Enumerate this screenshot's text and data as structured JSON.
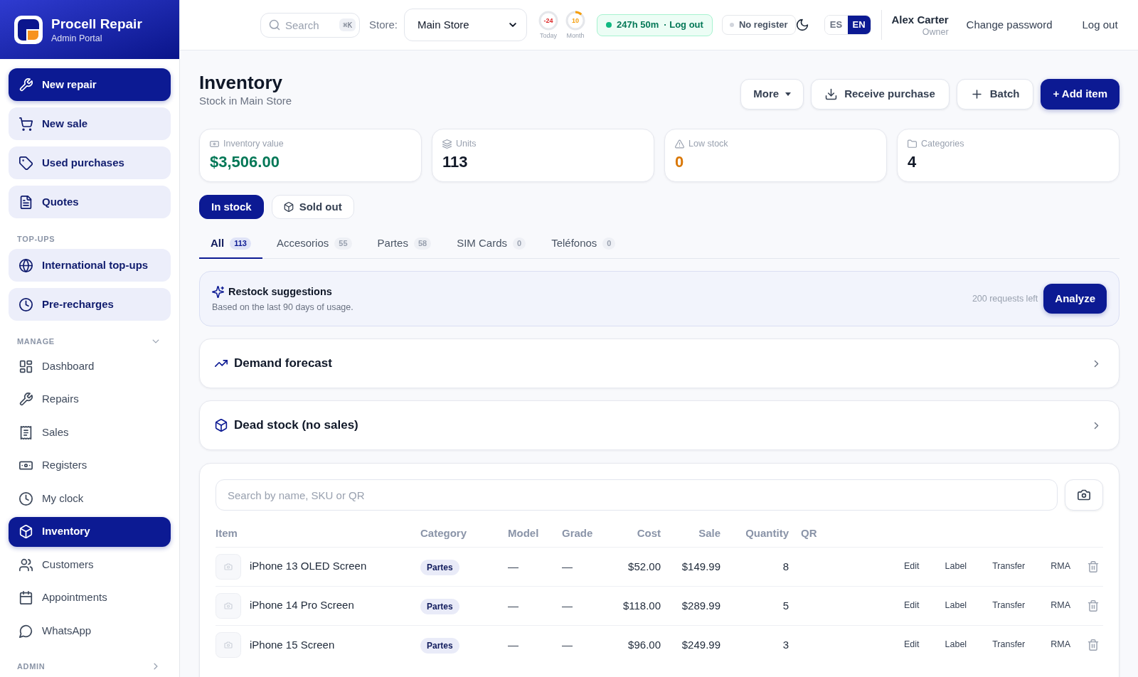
{
  "sidebar": {
    "brand": {
      "title": "Procell Repair",
      "subtitle": "Admin Portal"
    },
    "sections": [
      {
        "items": [
          {
            "label": "New repair",
            "kind": "primary"
          },
          {
            "label": "New sale",
            "kind": "action"
          },
          {
            "label": "Used purchases",
            "kind": "action"
          },
          {
            "label": "Quotes",
            "kind": "action"
          }
        ]
      },
      {
        "title": "TOP-UPS",
        "items": [
          {
            "label": "International top-ups",
            "kind": "action"
          },
          {
            "label": "Pre-recharges",
            "kind": "action"
          }
        ]
      },
      {
        "title": "MANAGE",
        "expanded": true,
        "items": [
          {
            "label": "Dashboard",
            "kind": "link",
            "selected": false
          },
          {
            "label": "Repairs",
            "kind": "link",
            "selected": false
          },
          {
            "label": "Sales",
            "kind": "link",
            "selected": false
          },
          {
            "label": "Registers",
            "kind": "link",
            "selected": false
          },
          {
            "label": "My clock",
            "kind": "link",
            "selected": false
          },
          {
            "label": "Inventory",
            "kind": "link",
            "selected": true
          },
          {
            "label": "Customers",
            "kind": "link",
            "selected": false
          },
          {
            "label": "Appointments",
            "kind": "link",
            "selected": false
          },
          {
            "label": "WhatsApp",
            "kind": "link",
            "selected": false
          }
        ]
      },
      {
        "title": "ADMIN",
        "expanded": false
      }
    ]
  },
  "topbar": {
    "search": {
      "placeholder": "Search",
      "shortcut": "⌘K"
    },
    "store": {
      "label": "Store:",
      "value": "Main Store"
    },
    "meters": [
      {
        "value": "-24",
        "caption": "Today",
        "level": 0,
        "color": "#dc2626"
      },
      {
        "value": "10",
        "caption": "Month",
        "level": 0.12,
        "color": "#f59e0b"
      }
    ],
    "clock": {
      "duration": "247h 50m",
      "action": "· Log out"
    },
    "register": {
      "label": "No register"
    },
    "languages": [
      {
        "label": "ES",
        "selected": false
      },
      {
        "label": "EN",
        "selected": true
      }
    ],
    "user": {
      "name": "Alex Carter",
      "role": "Owner"
    },
    "links": [
      "Change password",
      "Log out"
    ]
  },
  "page": {
    "title": "Inventory",
    "subtitle": "Stock in Main Store",
    "actions": [
      {
        "label": "More",
        "kind": "menu"
      },
      {
        "label": "Receive purchase",
        "kind": "secondary"
      },
      {
        "label": "Batch",
        "kind": "secondary"
      },
      {
        "label": "+ Add item",
        "kind": "primary"
      }
    ]
  },
  "stats": [
    {
      "label": "Inventory value",
      "value": "$3,506.00",
      "color": "#047857"
    },
    {
      "label": "Units",
      "value": "113",
      "color": "#111827"
    },
    {
      "label": "Low stock",
      "value": "0",
      "color": "#d97706"
    },
    {
      "label": "Categories",
      "value": "4",
      "color": "#111827"
    }
  ],
  "stock_filter": [
    {
      "label": "In stock",
      "selected": true
    },
    {
      "label": "Sold out",
      "selected": false
    }
  ],
  "category_tabs": [
    {
      "label": "All",
      "count": "113",
      "selected": true
    },
    {
      "label": "Accesorios",
      "count": "55",
      "selected": false
    },
    {
      "label": "Partes",
      "count": "58",
      "selected": false
    },
    {
      "label": "SIM Cards",
      "count": "0",
      "selected": false
    },
    {
      "label": "Teléfonos",
      "count": "0",
      "selected": false
    }
  ],
  "restock": {
    "title": "Restock suggestions",
    "note": "Based on the last 90 days of usage.",
    "quota": "200 requests left",
    "button": "Analyze"
  },
  "panels": [
    {
      "title": "Demand forecast",
      "expanded": false
    },
    {
      "title": "Dead stock (no sales)",
      "expanded": false
    }
  ],
  "table": {
    "search": {
      "placeholder": "Search by name, SKU or QR"
    },
    "columns": [
      "Item",
      "Category",
      "Model",
      "Grade",
      "Cost",
      "Sale",
      "Quantity",
      "QR"
    ],
    "rows": [
      {
        "item": "iPhone 13 OLED Screen",
        "category": "Partes",
        "model": "—",
        "grade": "—",
        "cost": "$52.00",
        "sale": "$149.99",
        "quantity": "8",
        "actions": [
          "Edit",
          "Label",
          "Transfer",
          "RMA"
        ]
      },
      {
        "item": "iPhone 14 Pro Screen",
        "category": "Partes",
        "model": "—",
        "grade": "—",
        "cost": "$118.00",
        "sale": "$289.99",
        "quantity": "5",
        "actions": [
          "Edit",
          "Label",
          "Transfer",
          "RMA"
        ]
      },
      {
        "item": "iPhone 15 Screen",
        "category": "Partes",
        "model": "—",
        "grade": "—",
        "cost": "$96.00",
        "sale": "$249.99",
        "quantity": "3",
        "actions": [
          "Edit",
          "Label",
          "Transfer",
          "RMA"
        ]
      }
    ]
  }
}
